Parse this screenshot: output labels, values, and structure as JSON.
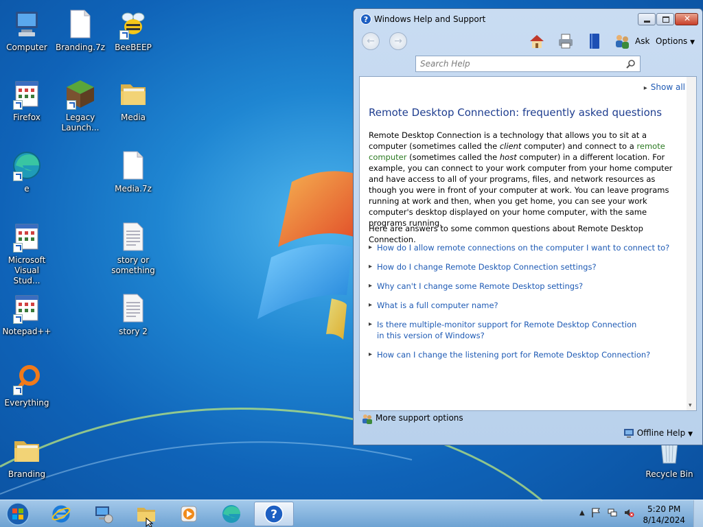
{
  "desktop": {
    "icons": [
      {
        "label": "Computer",
        "icon": "computer-icon"
      },
      {
        "label": "Branding.7z",
        "icon": "file-icon"
      },
      {
        "label": "BeeBEEP",
        "icon": "bee-icon"
      },
      {
        "label": "Firefox",
        "icon": "app-icon"
      },
      {
        "label": "Legacy Launch...",
        "icon": "minecraft-icon"
      },
      {
        "label": "Media",
        "icon": "folder-icon"
      },
      {
        "label": "e",
        "icon": "edge-icon"
      },
      {
        "label": "Media.7z",
        "icon": "file-icon"
      },
      {
        "label": "Microsoft Visual Stud...",
        "icon": "app-icon"
      },
      {
        "label": "story or something",
        "icon": "text-file-icon"
      },
      {
        "label": "Notepad++",
        "icon": "app-icon"
      },
      {
        "label": "story 2",
        "icon": "text-file-icon"
      },
      {
        "label": "Everything",
        "icon": "everything-icon"
      },
      {
        "label": "Branding",
        "icon": "folder-icon"
      },
      {
        "label": "Recycle Bin",
        "icon": "recycle-bin-icon"
      }
    ]
  },
  "window": {
    "title": "Windows Help and Support",
    "toolbar": {
      "ask_label": "Ask",
      "options_label": "Options"
    },
    "search": {
      "placeholder": "Search Help"
    },
    "content": {
      "show_all": "Show all",
      "heading": "Remote Desktop Connection: frequently asked questions",
      "intro_parts": [
        "Remote Desktop Connection is a technology that allows you to sit at a computer (sometimes called the ",
        "client",
        " computer) and connect to a ",
        "remote computer",
        " (sometimes called the ",
        "host",
        " computer) in a different location. For example, you can connect to your work computer from your home computer and have access to all of your programs, files, and network resources as though you were in front of your computer at work. You can leave programs running at work and then, when you get home, you can see your work computer's desktop displayed on your home computer, with the same programs running."
      ],
      "answers_intro": "Here are answers to some common questions about Remote Desktop Connection.",
      "faqs": [
        "How do I allow remote connections on the computer I want to connect to?",
        "How do I change Remote Desktop Connection settings?",
        "Why can't I change some Remote Desktop settings?",
        "What is a full computer name?",
        "Is there multiple-monitor support for Remote Desktop Connection in this version of Windows?",
        "How can I change the listening port for Remote Desktop Connection?"
      ]
    },
    "footer": {
      "more_support": "More support options",
      "offline_help": "Offline Help"
    }
  },
  "taskbar": {
    "items": [
      "internet-explorer-icon",
      "network-computer-icon",
      "file-explorer-icon",
      "media-player-icon",
      "edge-icon",
      "help-icon"
    ],
    "clock": {
      "time": "5:20 PM",
      "date": "8/14/2024"
    }
  }
}
